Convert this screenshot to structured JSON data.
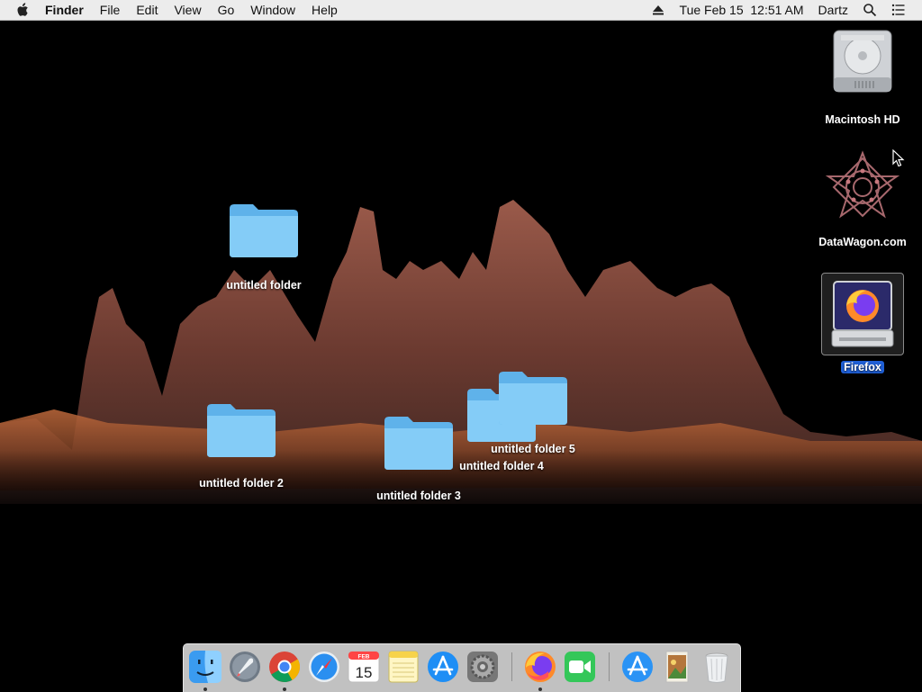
{
  "menubar": {
    "app_name": "Finder",
    "menus": [
      "File",
      "Edit",
      "View",
      "Go",
      "Window",
      "Help"
    ],
    "clock": "Tue Feb 15  12:51 AM",
    "user": "Dartz",
    "icons": [
      "apple-icon",
      "eject-icon",
      "spotlight-icon",
      "notification-center-icon"
    ]
  },
  "desktop": {
    "drives": [
      {
        "label": "Macintosh HD",
        "icon": "hard-drive-icon"
      },
      {
        "label": "DataWagon.com",
        "icon": "datawagon-logo-icon"
      },
      {
        "label": "Firefox",
        "icon": "firefox-disk-image-icon",
        "selected": true
      }
    ],
    "folders": [
      {
        "label": "untitled folder"
      },
      {
        "label": "untitled folder 2"
      },
      {
        "label": "untitled folder 3"
      },
      {
        "label": "untitled folder 4"
      },
      {
        "label": "untitled folder 5"
      }
    ]
  },
  "dock": {
    "calendar_month": "FEB",
    "calendar_day": "15",
    "items": [
      "finder",
      "launchpad",
      "chrome",
      "safari",
      "calendar",
      "notes",
      "app-store",
      "system-preferences",
      "firefox",
      "facetime",
      "downloads",
      "preview",
      "trash"
    ]
  },
  "colors": {
    "menubar_bg": "#ececec",
    "folder_blue": "#7cc7f5",
    "selection_blue": "#1f5fd6"
  }
}
